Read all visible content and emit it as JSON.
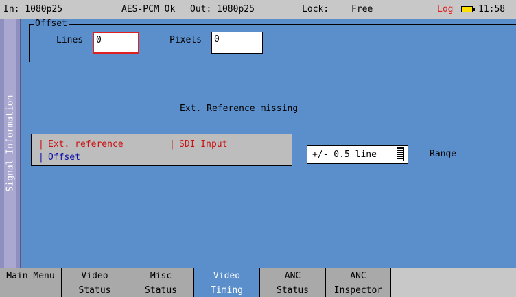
{
  "status": {
    "input": "In: 1080p25",
    "audio": "AES-PCM Ok",
    "output": "Out: 1080p25",
    "lock_label": "Lock:",
    "lock_value": "Free",
    "log": "Log",
    "time": "11:58",
    "battery_icon": "battery-icon",
    "colors": {
      "log": "#e02020",
      "battery": "#ffe000"
    }
  },
  "sidebar": {
    "label": "Signal Information"
  },
  "offset": {
    "title": "Offset",
    "lines_label": "Lines",
    "lines_value": "0",
    "pixels_label": "Pixels",
    "pixels_value": "0"
  },
  "message": "Ext. Reference missing",
  "legend": {
    "ext_reference": "Ext. reference",
    "sdi_input": "SDI Input",
    "offset": "Offset",
    "marker": "|",
    "colors": {
      "ext_reference": "#cc1010",
      "sdi_input": "#cc1010",
      "offset": "#1010aa"
    }
  },
  "range": {
    "selected": "+/- 0.5 line",
    "label": "Range"
  },
  "tabs": [
    {
      "l1": "Main Menu",
      "l2": ""
    },
    {
      "l1": "Video",
      "l2": "Status"
    },
    {
      "l1": "Misc",
      "l2": "Status"
    },
    {
      "l1": "Video",
      "l2": "Timing"
    },
    {
      "l1": "ANC",
      "l2": "Status"
    },
    {
      "l1": "ANC",
      "l2": "Inspector"
    }
  ],
  "active_tab": "Video Timing",
  "colors": {
    "panel": "#5b8fcb",
    "status_bar": "#c8c8c8"
  }
}
